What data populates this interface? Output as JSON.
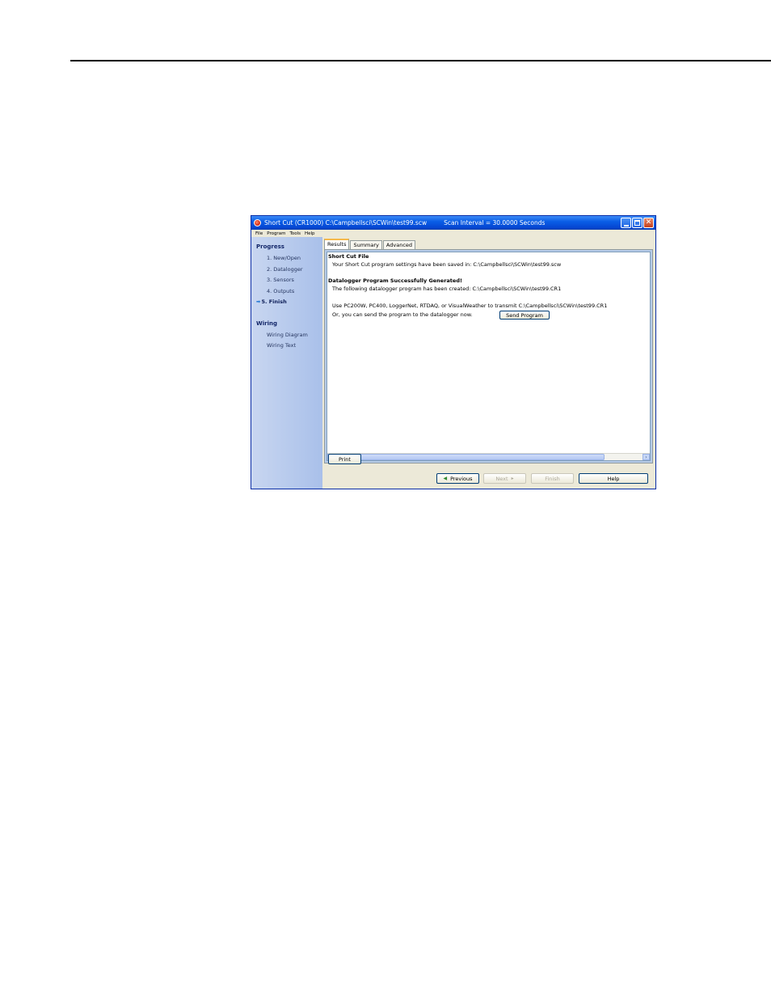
{
  "window": {
    "title": "Short Cut (CR1000) C:\\Campbellsci\\SCWin\\test99.scw",
    "scan_interval": "Scan Interval = 30.0000 Seconds"
  },
  "menu": [
    "File",
    "Program",
    "Tools",
    "Help"
  ],
  "sidebar": {
    "progress_heading": "Progress",
    "progress_items": [
      "1. New/Open",
      "2. Datalogger",
      "3. Sensors",
      "4. Outputs",
      "5. Finish"
    ],
    "wiring_heading": "Wiring",
    "wiring_items": [
      "Wiring Diagram",
      "Wiring Text"
    ]
  },
  "tabs": [
    "Results",
    "Summary",
    "Advanced"
  ],
  "results": {
    "file_heading": "Short Cut File",
    "file_line": "Your Short Cut program settings have been saved in: C:\\Campbellsci\\SCWin\\test99.scw",
    "gen_heading": "Datalogger Program Successfully Generated!",
    "gen_line": "The following datalogger program has been created: C:\\Campbellsci\\SCWin\\test99.CR1",
    "use_line": "Use PC200W, PC400, LoggerNet, RTDAQ, or VisualWeather to transmit C:\\Campbellsci\\SCWin\\test99.CR1",
    "send_line": "Or, you can send the program to the datalogger now.",
    "send_button": "Send Program"
  },
  "buttons": {
    "print": "Print",
    "previous": "Previous",
    "next": "Next",
    "finish": "Finish",
    "help": "Help"
  }
}
